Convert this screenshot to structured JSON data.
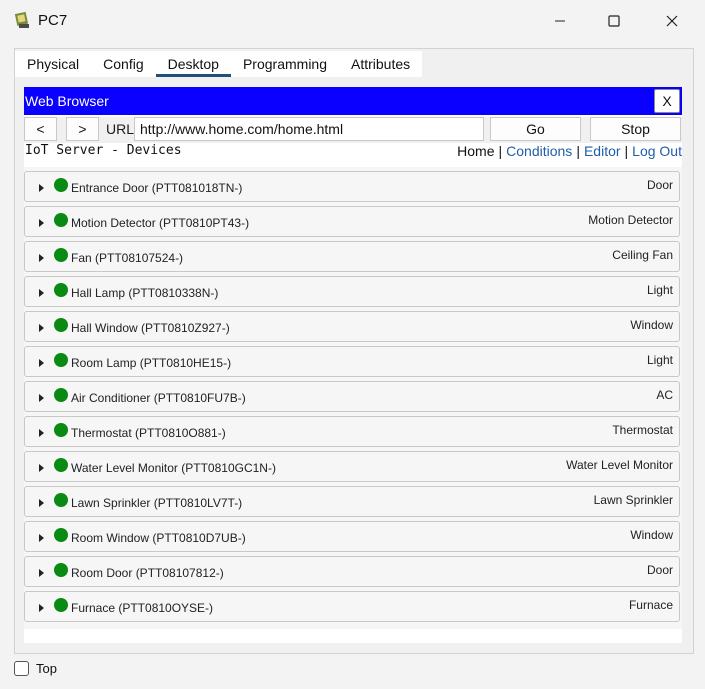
{
  "window": {
    "title": "PC7"
  },
  "tabs": [
    {
      "label": "Physical"
    },
    {
      "label": "Config"
    },
    {
      "label": "Desktop",
      "active": true
    },
    {
      "label": "Programming"
    },
    {
      "label": "Attributes"
    }
  ],
  "browser": {
    "title": "Web Browser",
    "close_label": "X",
    "back_label": "<",
    "forward_label": ">",
    "url_label": "URL",
    "url_value": "http://www.home.com/home.html",
    "go_label": "Go",
    "stop_label": "Stop",
    "title_bar_color": "#0a00ff"
  },
  "page": {
    "heading": "IoT Server - Devices",
    "nav": {
      "home": "Home",
      "conditions": "Conditions",
      "editor": "Editor",
      "logout": "Log Out"
    },
    "status_color": "#0a8a12",
    "devices": [
      {
        "name": "Entrance Door (PTT081018TN-)",
        "type": "Door"
      },
      {
        "name": "Motion Detector (PTT0810PT43-)",
        "type": "Motion Detector"
      },
      {
        "name": "Fan (PTT08107524-)",
        "type": "Ceiling Fan"
      },
      {
        "name": "Hall Lamp (PTT0810338N-)",
        "type": "Light"
      },
      {
        "name": "Hall Window (PTT0810Z927-)",
        "type": "Window"
      },
      {
        "name": "Room Lamp (PTT0810HE15-)",
        "type": "Light"
      },
      {
        "name": "Air Conditioner (PTT0810FU7B-)",
        "type": "AC"
      },
      {
        "name": "Thermostat (PTT0810O881-)",
        "type": "Thermostat"
      },
      {
        "name": "Water Level Monitor (PTT0810GC1N-)",
        "type": "Water Level Monitor"
      },
      {
        "name": "Lawn Sprinkler (PTT0810LV7T-)",
        "type": "Lawn Sprinkler"
      },
      {
        "name": "Room Window (PTT0810D7UB-)",
        "type": "Window"
      },
      {
        "name": "Room Door (PTT08107812-)",
        "type": "Door"
      },
      {
        "name": "Furnace (PTT0810OYSE-)",
        "type": "Furnace"
      }
    ]
  },
  "footer": {
    "top_label": "Top"
  }
}
